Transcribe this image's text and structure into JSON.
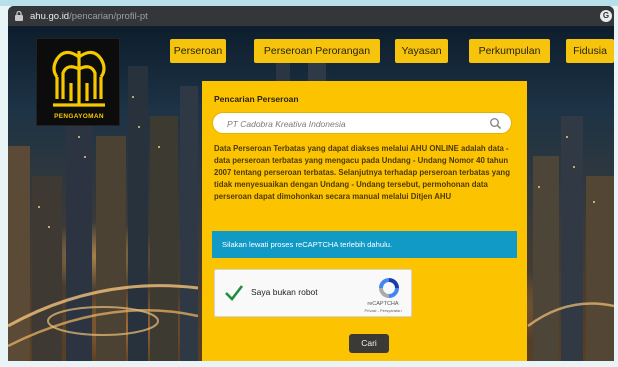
{
  "browser": {
    "url_host": "ahu.go.id",
    "url_path": "/pencarian/profil-pt"
  },
  "logo": {
    "text": "PENGAYOMAN",
    "icon": "banyan-tree-icon"
  },
  "nav": {
    "items": [
      {
        "label": "Perseroan"
      },
      {
        "label": "Perseroan Perorangan"
      },
      {
        "label": "Yayasan"
      },
      {
        "label": "Perkumpulan"
      },
      {
        "label": "Fidusia"
      }
    ]
  },
  "search_panel": {
    "title": "Pencarian Perseroan",
    "search_placeholder": "PT Cadobra Kreativa Indonesia",
    "search_value": "",
    "description": "Data Perseroan Terbatas yang dapat diakses melalui AHU ONLINE adalah data - data perseroan terbatas yang mengacu pada Undang - Undang Nomor 40 tahun 2007 tentang perseroan terbatas. Selanjutnya terhadap perseroan terbatas yang tidak menyesuaikan dengan Undang - Undang tersebut, permohonan data perseroan dapat dimohonkan secara manual melalui Ditjen AHU",
    "notice": "Silakan lewati proses reCAPTCHA terlebih dahulu.",
    "recaptcha_label": "Saya bukan robot",
    "recaptcha_brand": "reCAPTCHA",
    "recaptcha_links": "Privasi - Persyaratan",
    "submit_label": "Cari"
  },
  "colors": {
    "accent": "#fcc400",
    "notice": "#129ac7",
    "button_dark": "#3b3a37",
    "check": "#1e8e3e"
  }
}
